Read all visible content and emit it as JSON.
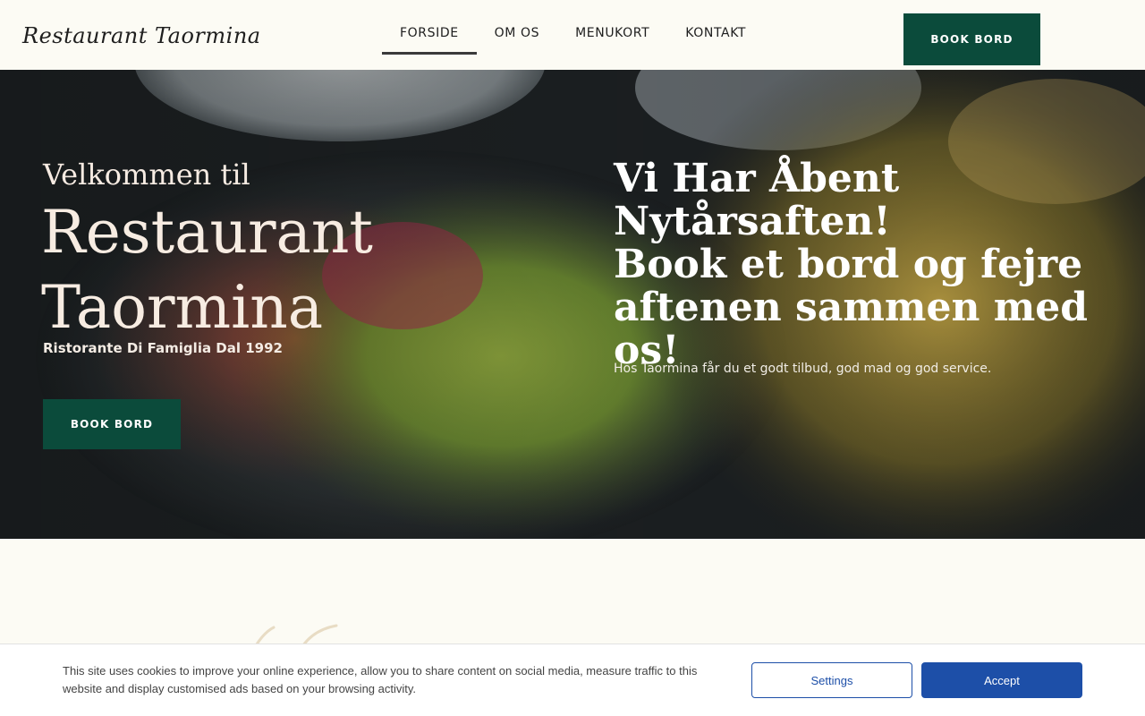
{
  "header": {
    "logo": "Restaurant Taormina",
    "nav": [
      {
        "label": "FORSIDE",
        "active": true
      },
      {
        "label": "OM OS",
        "active": false
      },
      {
        "label": "MENUKORT",
        "active": false
      },
      {
        "label": "KONTAKT",
        "active": false
      }
    ],
    "book_label": "BOOK BORD"
  },
  "hero": {
    "welcome": "Velkommen til",
    "title_line1": "Restaurant",
    "title_line2": "Taormina",
    "tagline": "Ristorante Di Famiglia Dal 1992",
    "book_label": "BOOK BORD",
    "announcement": {
      "line1": "Vi Har Åbent",
      "line2": "Nytårsaften!",
      "line3": "Book et bord og fejre",
      "line4": "aftenen sammen med os!"
    },
    "subtext": "Hos Taormina får du et godt tilbud, god mad og god service."
  },
  "cookie_banner": {
    "text": "This site uses cookies to improve your online experience, allow you to share content on social media, measure traffic to this website and display customised ads based on your browsing activity.",
    "settings_label": "Settings",
    "accept_label": "Accept"
  },
  "colors": {
    "brand_green": "#0b4b3b",
    "page_bg": "#fcfbf4",
    "cookie_blue": "#1d4fa8"
  }
}
